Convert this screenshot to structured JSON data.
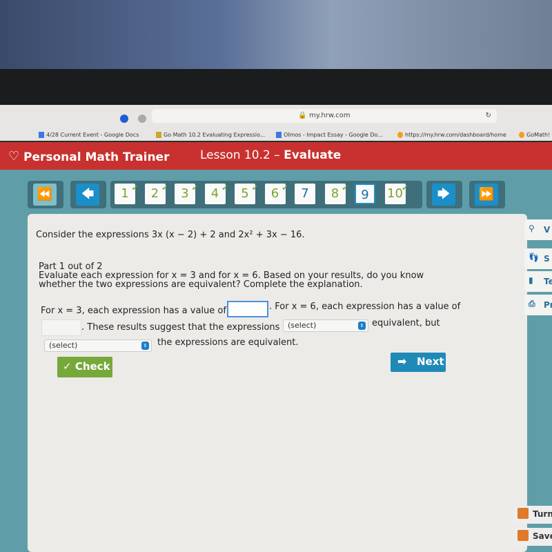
{
  "browser": {
    "url": "my.hrw.com",
    "tabs": [
      {
        "label": "4/28 Current Event - Google Docs",
        "color": "#3b78e7"
      },
      {
        "label": "Go Math 10.2 Evaluating Expressio...",
        "color": "#c9a82a"
      },
      {
        "label": "Olmos - Impact Essay - Google Do...",
        "color": "#3b78e7"
      },
      {
        "label": "https://my.hrw.com/dashboard/home",
        "color": "#f0a020"
      },
      {
        "label": "GoMath!",
        "color": "#f0a020"
      }
    ]
  },
  "header": {
    "app_name": "Personal Math Trainer",
    "lesson_prefix": "Lesson 10.2 –",
    "lesson_title": "Evaluate"
  },
  "nav": {
    "first": "⏪",
    "prev": "🡄",
    "next": "🡆",
    "last": "⏩",
    "questions": [
      {
        "label": "1",
        "done": true
      },
      {
        "label": "2",
        "done": true
      },
      {
        "label": "3",
        "done": true
      },
      {
        "label": "4",
        "done": true
      },
      {
        "label": "5",
        "done": true
      },
      {
        "label": "6",
        "done": true
      },
      {
        "label": "7",
        "done": false
      },
      {
        "label": "8",
        "done": true
      },
      {
        "label": "9",
        "done": false,
        "current": true
      },
      {
        "label": "10",
        "done": true
      }
    ]
  },
  "question": {
    "prompt": "Consider the expressions 3x (x − 2) + 2 and 2x² + 3x − 16.",
    "part": "Part 1 out of 2",
    "instructions_1": "Evaluate each expression for x = 3 and for x = 6. Based on your results, do you know",
    "instructions_2": "whether the two expressions are equivalent? Complete the explanation.",
    "s1": "For x = 3, each expression has a value of",
    "s2": ". For x = 6, each expression has a value of",
    "s3": ". These results suggest that the expressions",
    "s4": "equivalent, but",
    "s5": "the expressions are equivalent.",
    "value_x3": "",
    "value_x6": "",
    "select1": "(select)",
    "select2": "(select)"
  },
  "buttons": {
    "check": "Check",
    "next": "Next"
  },
  "side_tools": [
    "V",
    "S",
    "Te",
    "Pr"
  ],
  "bottom_tools": [
    "Turn",
    "Save"
  ]
}
